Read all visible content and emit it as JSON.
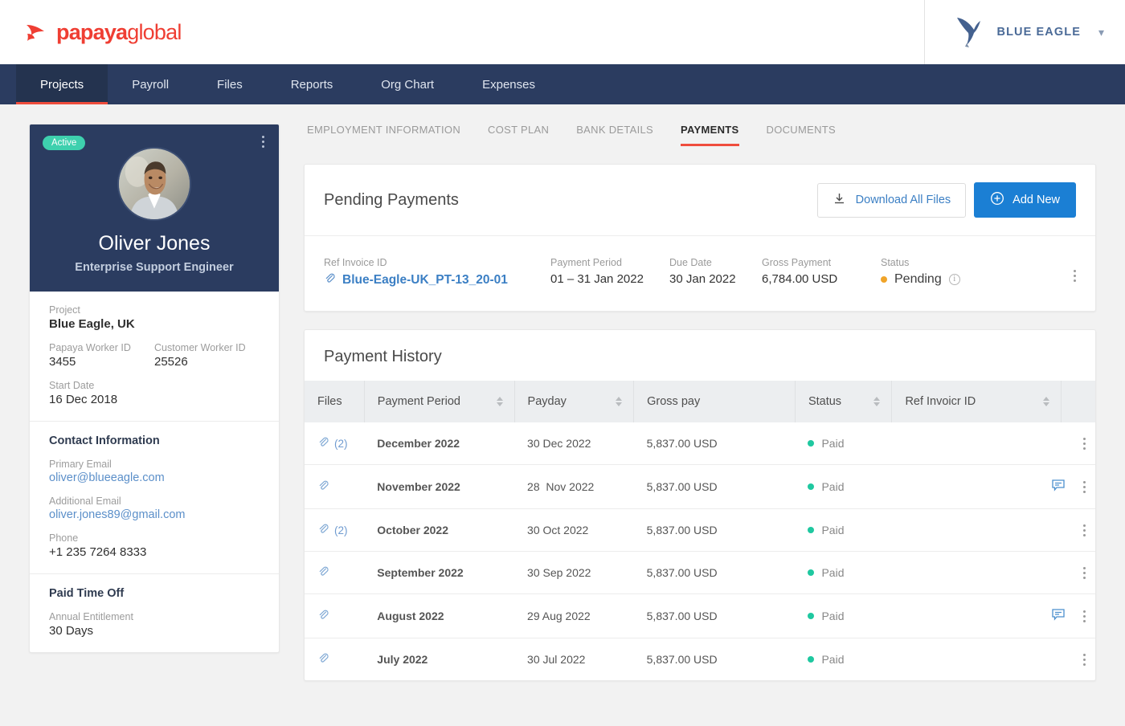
{
  "brand": {
    "name_bold": "papaya",
    "name_light": "global",
    "logo_icon": "papaya-bird-icon"
  },
  "org": {
    "name": "BLUE EAGLE",
    "logo_icon": "eagle-icon",
    "caret_icon": "chevron-down-icon"
  },
  "nav": {
    "items": [
      {
        "label": "Projects",
        "active": true
      },
      {
        "label": "Payroll",
        "active": false
      },
      {
        "label": "Files",
        "active": false
      },
      {
        "label": "Reports",
        "active": false
      },
      {
        "label": "Org Chart",
        "active": false
      },
      {
        "label": "Expenses",
        "active": false
      }
    ]
  },
  "profile": {
    "status_badge": "Active",
    "name": "Oliver Jones",
    "role": "Enterprise Support Engineer",
    "project_label": "Project",
    "project_value": "Blue Eagle, UK",
    "papaya_worker_id_label": "Papaya Worker ID",
    "papaya_worker_id_value": "3455",
    "customer_worker_id_label": "Customer Worker ID",
    "customer_worker_id_value": "25526",
    "start_date_label": "Start Date",
    "start_date_value": "16 Dec 2018",
    "contact_heading": "Contact Information",
    "primary_email_label": "Primary Email",
    "primary_email_value": "oliver@blueeagle.com",
    "additional_email_label": "Additional Email",
    "additional_email_value": "oliver.jones89@gmail.com",
    "phone_label": "Phone",
    "phone_value": "+1 235 7264 8333",
    "pto_heading": "Paid Time Off",
    "annual_entitlement_label": "Annual Entitlement",
    "annual_entitlement_value": "30 Days"
  },
  "subtabs": [
    {
      "label": "EMPLOYMENT INFORMATION",
      "active": false
    },
    {
      "label": "COST PLAN",
      "active": false
    },
    {
      "label": "BANK DETAILS",
      "active": false
    },
    {
      "label": "PAYMENTS",
      "active": true
    },
    {
      "label": "DOCUMENTS",
      "active": false
    }
  ],
  "pending": {
    "title": "Pending Payments",
    "download_label": "Download All Files",
    "add_new_label": "Add New",
    "ref_invoice_label": "Ref Invoice ID",
    "ref_invoice_value": "Blue-Eagle-UK_PT-13_20-01",
    "payment_period_label": "Payment Period",
    "payment_period_value": "01 – 31 Jan 2022",
    "due_date_label": "Due Date",
    "due_date_value": "30 Jan 2022",
    "gross_payment_label": "Gross Payment",
    "gross_payment_value": "6,784.00 USD",
    "status_label": "Status",
    "status_value": "Pending"
  },
  "history": {
    "title": "Payment History",
    "columns": [
      {
        "label": "Files",
        "sortable": false
      },
      {
        "label": "Payment Period",
        "sortable": true
      },
      {
        "label": "Payday",
        "sortable": true
      },
      {
        "label": "Gross pay",
        "sortable": false
      },
      {
        "label": "Status",
        "sortable": true
      },
      {
        "label": "Ref Invoicr ID",
        "sortable": true
      }
    ],
    "rows": [
      {
        "files_count": "(2)",
        "period": "December 2022",
        "payday": "30 Dec 2022",
        "gross": "5,837.00 USD",
        "status": "Paid",
        "ref_invoice": "",
        "has_comment": false
      },
      {
        "files_count": "",
        "period": "November 2022",
        "payday": "28  Nov 2022",
        "gross": "5,837.00 USD",
        "status": "Paid",
        "ref_invoice": "",
        "has_comment": true
      },
      {
        "files_count": "(2)",
        "period": "October 2022",
        "payday": "30 Oct 2022",
        "gross": "5,837.00 USD",
        "status": "Paid",
        "ref_invoice": "",
        "has_comment": false
      },
      {
        "files_count": "",
        "period": "September 2022",
        "payday": "30 Sep 2022",
        "gross": "5,837.00 USD",
        "status": "Paid",
        "ref_invoice": "",
        "has_comment": false
      },
      {
        "files_count": "",
        "period": "August 2022",
        "payday": "29 Aug 2022",
        "gross": "5,837.00 USD",
        "status": "Paid",
        "ref_invoice": "",
        "has_comment": true
      },
      {
        "files_count": "",
        "period": "July 2022",
        "payday": "30 Jul 2022",
        "gross": "5,837.00 USD",
        "status": "Paid",
        "ref_invoice": "",
        "has_comment": false
      }
    ]
  },
  "colors": {
    "brand_red": "#ef3e33",
    "nav_navy": "#2b3c60",
    "accent_blue": "#1b7fd4",
    "status_paid": "#1fc8a0",
    "status_pending": "#f0a429",
    "badge_active": "#3ed0ae"
  }
}
